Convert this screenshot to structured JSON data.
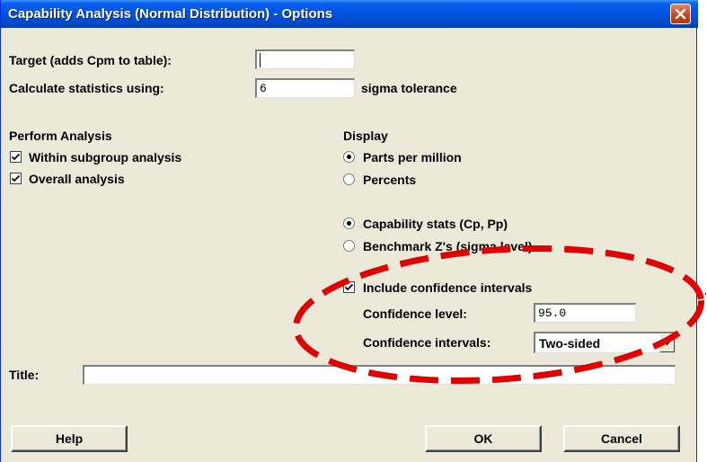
{
  "window": {
    "title": "Capability Analysis (Normal Distribution) - Options"
  },
  "target": {
    "label": "Target (adds Cpm to table):",
    "value": ""
  },
  "statistics": {
    "label": "Calculate statistics using:",
    "value": "6",
    "suffix": "sigma tolerance"
  },
  "perform_analysis": {
    "heading": "Perform Analysis",
    "items": [
      {
        "label": "Within subgroup analysis",
        "checked": true
      },
      {
        "label": "Overall analysis",
        "checked": true
      }
    ]
  },
  "display": {
    "heading": "Display",
    "units": [
      {
        "label": "Parts per million",
        "selected": true
      },
      {
        "label": "Percents",
        "selected": false
      }
    ],
    "stats": [
      {
        "label": "Capability stats (Cp, Pp)",
        "selected": true
      },
      {
        "label": "Benchmark Z's (sigma level)",
        "selected": false
      }
    ]
  },
  "confidence": {
    "include_label": "Include confidence intervals",
    "include_checked": true,
    "level_label": "Confidence level:",
    "level_value": "95.0",
    "intervals_label": "Confidence intervals:",
    "intervals_value": "Two-sided"
  },
  "title_field": {
    "label": "Title:",
    "value": ""
  },
  "buttons": {
    "help": "Help",
    "ok": "OK",
    "cancel": "Cancel"
  },
  "annotation": {
    "color": "#e00000",
    "shape": "dashed-ellipse"
  },
  "icons": {
    "close": "close-icon",
    "check": "checkmark-icon",
    "dropdown": "chevron-down-icon"
  }
}
